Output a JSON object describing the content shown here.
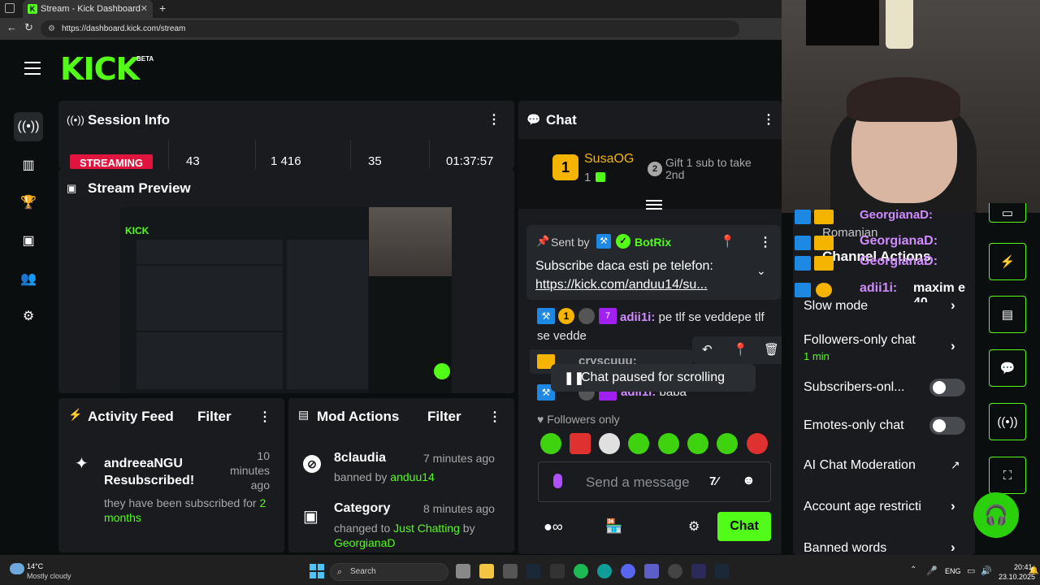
{
  "browser": {
    "tab_title": "Stream - Kick Dashboard",
    "url": "https://dashboard.kick.com/stream"
  },
  "app": {
    "logo_text": "KICK",
    "beta_label": "BETA",
    "brand_color": "#53fc18"
  },
  "sidebar": {
    "icons": [
      "broadcast-icon",
      "chart-icon",
      "trophy-icon",
      "video-icon",
      "users-icon",
      "gear-icon"
    ]
  },
  "session": {
    "title": "Session Info",
    "status": "STREAMING",
    "stats": [
      "43",
      "1 416",
      "35",
      "01:37:57"
    ]
  },
  "preview": {
    "title": "Stream Preview"
  },
  "activity": {
    "title": "Activity Feed",
    "filter_label": "Filter",
    "item": {
      "user": "andreeaNGU",
      "action": "Resubscribed!",
      "time": "10\nminutes\nago",
      "detail_prefix": "they have been subscribed for ",
      "detail_months": "2 months"
    }
  },
  "mod_actions": {
    "title": "Mod Actions",
    "filter_label": "Filter",
    "items": [
      {
        "title": "8claudia",
        "time": "7 minutes ago",
        "prefix": "banned by ",
        "user": "anduu14"
      },
      {
        "title": "Category",
        "time": "8 minutes ago",
        "prefix": "changed to ",
        "user": "Just Chatting",
        "suffix": " by",
        "user2": "GeorgianaD"
      }
    ]
  },
  "chat": {
    "title": "Chat",
    "top_gifter": {
      "name": "SusaOG",
      "count": "1",
      "rank": "1"
    },
    "gift_cta": "Gift 1 sub to take 2nd",
    "gift_rank": "2",
    "pinned": {
      "sent_by": "Sent by",
      "bot": "BotRix",
      "message": "Subscribe daca esti pe telefon:",
      "link": "https://kick.com/anduu14/su..."
    },
    "messages": [
      {
        "user": "adii1i:",
        "text": "pe tlf se veddepe tlf se vedde"
      },
      {
        "user": "cryscuuu:",
        "text": ""
      },
      {
        "user": "adii1i:",
        "text": "baba"
      }
    ],
    "paused_label": "Chat paused for scrolling",
    "followers_only": "Followers only",
    "input_placeholder": "Send a message",
    "send_button": "Chat"
  },
  "overlay_chat": [
    {
      "user": "GeorgianaD:",
      "text": ""
    },
    {
      "user": "GeorgianaD:",
      "text": ""
    },
    {
      "user": "GeorgianaD:",
      "text": ""
    },
    {
      "user": "adii1i:",
      "text": "maxim e 40"
    }
  ],
  "overlay_fragments": [
    "Romanian",
    "Channel Actions"
  ],
  "chat_settings": {
    "slow_mode": "Slow mode",
    "followers_only_chat": "Followers-only chat",
    "followers_duration": "1 min",
    "subscribers_only": "Subscribers-onl...",
    "emotes_only": "Emotes-only chat",
    "ai_moderation": "AI Chat Moderation",
    "account_age": "Account age restricti",
    "banned_words": "Banned words"
  },
  "taskbar": {
    "temp": "14°C",
    "weather": "Mostly cloudy",
    "search_placeholder": "Search",
    "lang": "ENG",
    "time": "20:41",
    "date": "23.10.2025"
  }
}
